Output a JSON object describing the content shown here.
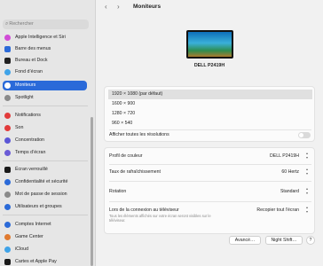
{
  "sidebar": {
    "search_placeholder": "Rechercher",
    "items": [
      {
        "label": "Apple Intelligence et Siri",
        "color": "#d14bd6"
      },
      {
        "label": "Barre des menus",
        "color": "#2b6ad8"
      },
      {
        "label": "Bureau et Dock",
        "color": "#202020"
      },
      {
        "label": "Fond d’écran",
        "color": "#3fa3e8"
      },
      {
        "label": "Moniteurs",
        "color": "#2b6ad8"
      },
      {
        "label": "Spotlight",
        "color": "#8a8a8a"
      },
      {
        "label": "Notifications",
        "color": "#e23b3b"
      },
      {
        "label": "Son",
        "color": "#e23b3b"
      },
      {
        "label": "Concentration",
        "color": "#5b56d6"
      },
      {
        "label": "Temps d’écran",
        "color": "#6a5bd6"
      },
      {
        "label": "Écran verrouillé",
        "color": "#1a1a1a"
      },
      {
        "label": "Confidentialité et sécurité",
        "color": "#2b6ad8"
      },
      {
        "label": "Mot de passe de session",
        "color": "#8a8a8a"
      },
      {
        "label": "Utilisateurs et groupes",
        "color": "#2b6ad8"
      },
      {
        "label": "Comptes Internet",
        "color": "#2b6ad8"
      },
      {
        "label": "Game Center",
        "color": "#e07a30"
      },
      {
        "label": "iCloud",
        "color": "#3fa3e8"
      },
      {
        "label": "Cartes et Apple Pay",
        "color": "#1a1a1a"
      }
    ]
  },
  "header": {
    "title": "Moniteurs",
    "back": "‹",
    "forward": "›"
  },
  "display": {
    "name": "DELL P2419H"
  },
  "resolutions": {
    "options": [
      "1920 × 1080 (par défaut)",
      "1600 × 900",
      "1280 × 720",
      "960 × 540"
    ],
    "show_all_label": "Afficher toutes les résolutions"
  },
  "settings": {
    "color_profile": {
      "label": "Profil de couleur",
      "value": "DELL P2419H"
    },
    "refresh_rate": {
      "label": "Taux de rafraîchissement",
      "value": "60 Hertz"
    },
    "rotation": {
      "label": "Rotation",
      "value": "Standard"
    },
    "tv_connection": {
      "label": "Lors de la connexion au téléviseur",
      "value": "Recopier tout l’écran",
      "hint": "Tous les éléments affichés sur votre écran seront visibles sur le téléviseur."
    }
  },
  "buttons": {
    "advanced": "Avancé…",
    "night_shift": "Night Shift…",
    "help": "?"
  }
}
